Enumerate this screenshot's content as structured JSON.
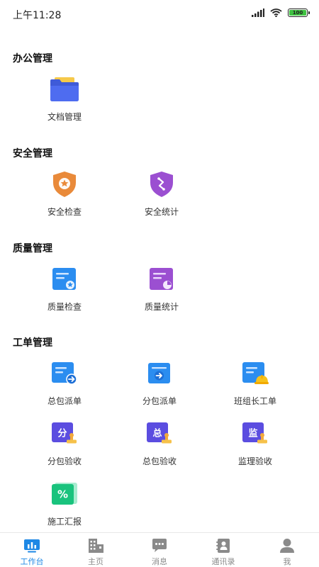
{
  "status": {
    "time": "上午11:28",
    "battery": "100"
  },
  "sections": [
    {
      "title": "办公管理",
      "items": [
        {
          "label": "文档管理",
          "icon": "folder-icon"
        }
      ]
    },
    {
      "title": "安全管理",
      "items": [
        {
          "label": "安全检查",
          "icon": "shield-star-icon"
        },
        {
          "label": "安全统计",
          "icon": "shield-chart-icon"
        }
      ]
    },
    {
      "title": "质量管理",
      "items": [
        {
          "label": "质量检查",
          "icon": "doc-star-icon"
        },
        {
          "label": "质量统计",
          "icon": "doc-pie-icon"
        }
      ]
    },
    {
      "title": "工单管理",
      "items": [
        {
          "label": "总包派单",
          "icon": "doc-dispatch-icon"
        },
        {
          "label": "分包派单",
          "icon": "box-dispatch-icon"
        },
        {
          "label": "班组长工单",
          "icon": "doc-helmet-icon"
        },
        {
          "label": "分包验收",
          "icon": "stamp-fen-icon",
          "glyph": "分"
        },
        {
          "label": "总包验收",
          "icon": "stamp-zong-icon",
          "glyph": "总"
        },
        {
          "label": "监理验收",
          "icon": "stamp-jian-icon",
          "glyph": "监"
        },
        {
          "label": "施工汇报",
          "icon": "percent-report-icon",
          "glyph": "%"
        }
      ]
    }
  ],
  "tabs": [
    {
      "label": "工作台",
      "icon": "workbench-icon",
      "active": true
    },
    {
      "label": "主页",
      "icon": "building-icon",
      "active": false
    },
    {
      "label": "消息",
      "icon": "message-icon",
      "active": false
    },
    {
      "label": "通讯录",
      "icon": "contacts-icon",
      "active": false
    },
    {
      "label": "我",
      "icon": "user-icon",
      "active": false
    }
  ],
  "colors": {
    "accent": "#1e88e5",
    "tab_inactive": "#8a8a8a",
    "orange": "#e98a3a",
    "purple": "#9b4fd1",
    "blue": "#2b8df0",
    "indigo": "#5b4de0",
    "green": "#19c37d"
  }
}
